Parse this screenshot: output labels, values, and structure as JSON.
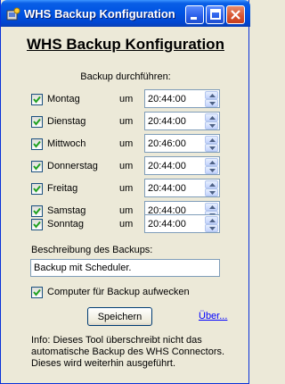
{
  "window": {
    "title": "WHS Backup Konfiguration"
  },
  "heading": "WHS Backup Konfiguration",
  "schedule": {
    "section_label": "Backup durchführen:",
    "days": [
      {
        "label": "Montag",
        "checked": true,
        "at_label": "um",
        "time": "20:44:00"
      },
      {
        "label": "Dienstag",
        "checked": true,
        "at_label": "um",
        "time": "20:44:00"
      },
      {
        "label": "Mittwoch",
        "checked": true,
        "at_label": "um",
        "time": "20:46:00"
      },
      {
        "label": "Donnerstag",
        "checked": true,
        "at_label": "um",
        "time": "20:44:00"
      },
      {
        "label": "Freitag",
        "checked": true,
        "at_label": "um",
        "time": "20:44:00"
      },
      {
        "label": "Samstag",
        "checked": true,
        "at_label": "um",
        "time": "20:44:00"
      },
      {
        "label": "Sonntag",
        "checked": true,
        "at_label": "um",
        "time": "20:44:00"
      }
    ]
  },
  "description": {
    "label": "Beschreibung des Backups:",
    "value": "Backup mit Scheduler."
  },
  "wake": {
    "label": "Computer für Backup aufwecken",
    "checked": true
  },
  "save_label": "Speichern",
  "about_label": "Über...",
  "info": "Info: Dieses Tool überschreibt nicht das automatische Backup des WHS Connectors. Dieses wird weiterhin ausgeführt.",
  "colors": {
    "titlebar": "#0054e3",
    "window_bg": "#ece9d8",
    "link": "#0000ff"
  }
}
